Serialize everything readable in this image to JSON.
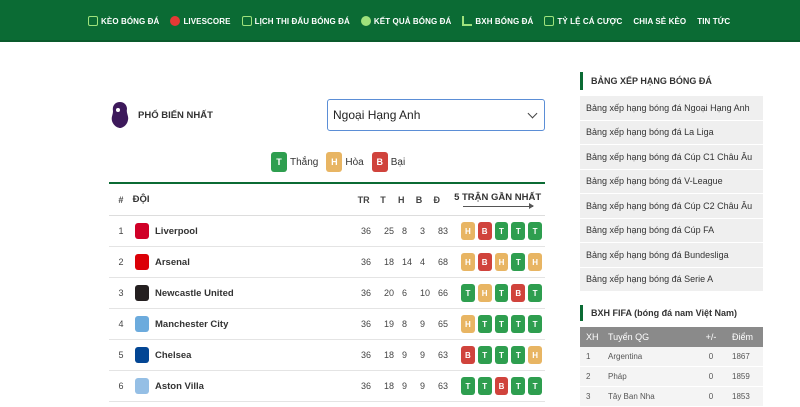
{
  "nav": [
    {
      "label": "Kèo bóng đá",
      "icon": "grid-icon"
    },
    {
      "label": "Livescore",
      "icon": "live-dot-icon"
    },
    {
      "label": "Lịch thi đấu bóng đá",
      "icon": "calendar-icon"
    },
    {
      "label": "Kết quả bóng đá",
      "icon": "ball-icon"
    },
    {
      "label": "BXH bóng đá",
      "icon": "chart-icon"
    },
    {
      "label": "Tỷ lệ cá cược",
      "icon": "odds-icon"
    },
    {
      "label": "Chia sẻ kèo",
      "icon": ""
    },
    {
      "label": "Tin tức",
      "icon": ""
    }
  ],
  "filter": {
    "popular_label": "PHỔ BIẾN NHẤT",
    "league_selected": "Ngoại Hạng Anh"
  },
  "legend": {
    "win_letter": "T",
    "win_label": "Thắng",
    "draw_letter": "H",
    "draw_label": "Hòa",
    "loss_letter": "B",
    "loss_label": "Bại"
  },
  "table": {
    "headers": {
      "rank": "#",
      "team": "ĐỘI",
      "played": "TR",
      "won": "T",
      "drawn": "H",
      "lost": "B",
      "points": "Đ",
      "form": "5 TRẬN GẦN NHẤT"
    },
    "rows": [
      {
        "rank": "1",
        "team": "Liverpool",
        "played": "36",
        "won": "25",
        "drawn": "8",
        "lost": "3",
        "points": "83",
        "form": [
          "H",
          "B",
          "T",
          "T",
          "T"
        ],
        "crest": "#d00027"
      },
      {
        "rank": "2",
        "team": "Arsenal",
        "played": "36",
        "won": "18",
        "drawn": "14",
        "lost": "4",
        "points": "68",
        "form": [
          "H",
          "B",
          "H",
          "T",
          "H"
        ],
        "crest": "#db0007"
      },
      {
        "rank": "3",
        "team": "Newcastle United",
        "played": "36",
        "won": "20",
        "drawn": "6",
        "lost": "10",
        "points": "66",
        "form": [
          "T",
          "H",
          "T",
          "B",
          "T"
        ],
        "crest": "#241f20"
      },
      {
        "rank": "4",
        "team": "Manchester City",
        "played": "36",
        "won": "19",
        "drawn": "8",
        "lost": "9",
        "points": "65",
        "form": [
          "H",
          "T",
          "T",
          "T",
          "T"
        ],
        "crest": "#6cabdd"
      },
      {
        "rank": "5",
        "team": "Chelsea",
        "played": "36",
        "won": "18",
        "drawn": "9",
        "lost": "9",
        "points": "63",
        "form": [
          "B",
          "T",
          "T",
          "T",
          "H"
        ],
        "crest": "#034694"
      },
      {
        "rank": "6",
        "team": "Aston Villa",
        "played": "36",
        "won": "18",
        "drawn": "9",
        "lost": "9",
        "points": "63",
        "form": [
          "T",
          "T",
          "B",
          "T",
          "T"
        ],
        "crest": "#95bfe5"
      }
    ]
  },
  "sidebar": {
    "title": "BẢNG XẾP HẠNG BÓNG ĐÁ",
    "links": [
      "Bảng xếp hạng bóng đá Ngoại Hạng Anh",
      "Bảng xếp hạng bóng đá La Liga",
      "Bảng xếp hạng bóng đá Cúp C1 Châu Âu",
      "Bảng xếp hạng bóng đá V-League",
      "Bảng xếp hạng bóng đá Cúp C2 Châu Âu",
      "Bảng xếp hạng bóng đá Cúp FA",
      "Bảng xếp hạng bóng đá Bundesliga",
      "Bảng xếp hạng bóng đá Serie A"
    ]
  },
  "fifa": {
    "title": "BXH FIFA (bóng đá nam Việt Nam)",
    "headers": {
      "rank": "XH",
      "team": "Tuyển QG",
      "change": "+/-",
      "points": "Điểm"
    },
    "rows": [
      {
        "rank": "1",
        "team": "Argentina",
        "change": "0",
        "points": "1867"
      },
      {
        "rank": "2",
        "team": "Pháp",
        "change": "0",
        "points": "1859"
      },
      {
        "rank": "3",
        "team": "Tây Ban Nha",
        "change": "0",
        "points": "1853"
      }
    ]
  },
  "colors": {
    "brand": "#0b6b34",
    "win": "#2e9e4f",
    "draw": "#e8b563",
    "loss": "#d0433c"
  }
}
